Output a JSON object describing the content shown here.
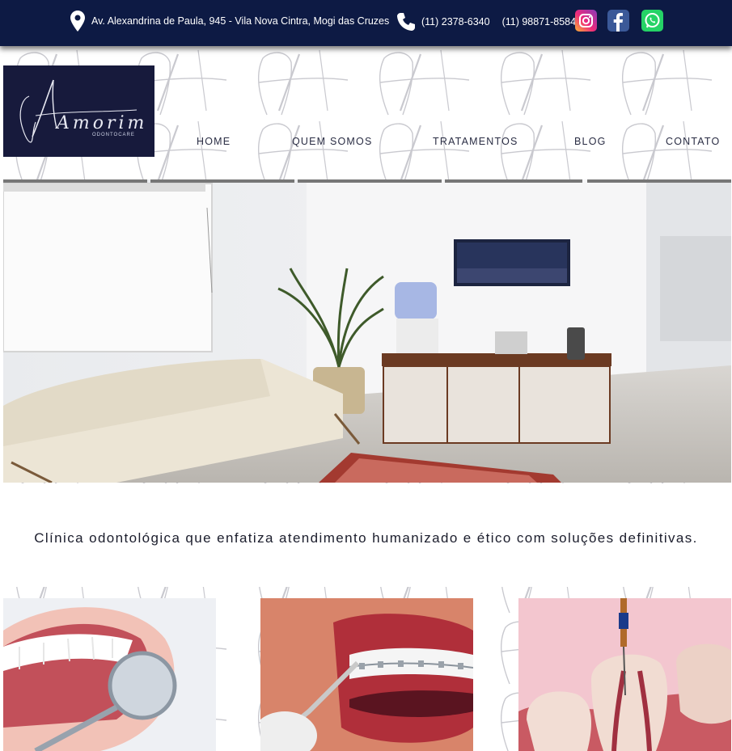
{
  "topbar": {
    "address": "Av. Alexandrina de Paula, 945 - Vila Nova Cintra, Mogi das Cruzes",
    "phone_1": "(11) 2378-6340",
    "phone_2": "(11) 98871-8584",
    "icons": [
      "location-pin-icon",
      "phone-icon",
      "instagram-icon",
      "facebook-icon",
      "whatsapp-icon"
    ]
  },
  "logo": {
    "name": "Amorim",
    "subtitle": "ODONTOCARE"
  },
  "nav": {
    "home": "HOME",
    "about": "QUEM SOMOS",
    "treatments": "TRATAMENTOS",
    "blog": "BLOG",
    "contact": "CONTATO"
  },
  "tagline": "Clínica odontológica que enfatiza atendimento humanizado e ético com soluções definitivas.",
  "colors": {
    "topbar_bg": "#0d1a44",
    "logo_bg": "#171a3c",
    "instagram": "#ee2a7b",
    "facebook": "#3b5998",
    "whatsapp": "#25d366"
  }
}
